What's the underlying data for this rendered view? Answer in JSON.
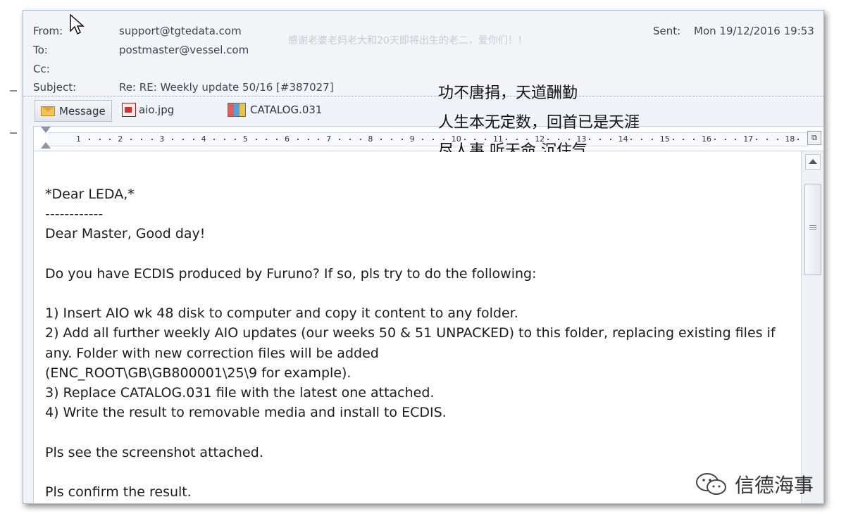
{
  "header": {
    "from_label": "From:",
    "from_value": "support@tgtedata.com",
    "to_label": "To:",
    "to_value": "postmaster@vessel.com",
    "cc_label": "Cc:",
    "subject_label": "Subject:",
    "subject_value": "Re: RE: Weekly update 50/16 [#387027]",
    "sent_label": "Sent:",
    "sent_value": "Mon 19/12/2016 19:53",
    "faint_note": "感谢老婆老妈老大和20天即将出生的老二，爱你们！！"
  },
  "attachments": {
    "message_label": "Message",
    "items": [
      "aio.jpg",
      "CATALOG.031"
    ]
  },
  "ruler": {
    "numbers": [
      "1",
      "2",
      "3",
      "4",
      "5",
      "6",
      "7",
      "8",
      "9",
      "10",
      "11",
      "12",
      "13",
      "14",
      "15",
      "16",
      "17",
      "18"
    ]
  },
  "body": {
    "lines": [
      "*Dear LEDA,*",
      "------------",
      "Dear Master, Good day!",
      "",
      "Do you have ECDIS produced by Furuno? If so, pls try to do the following:",
      "",
      "1) Insert AIO wk 48 disk to computer and copy it content to any folder.",
      "2) Add all further weekly AIO updates (our weeks 50 & 51 UNPACKED) to this folder, replacing existing files if",
      "any. Folder with new correction files will be added",
      "(ENC_ROOT\\GB\\GB800001\\25\\9 for example).",
      "3) Replace CATALOG.031 file with the latest one attached.",
      "4) Write the result to removable media and install to ECDIS.",
      "",
      "Pls see the screenshot attached.",
      "",
      "Pls confirm the result."
    ]
  },
  "overlay": {
    "line1": "功不唐捐，天道酬勤",
    "line2": "人生本无定数，回首已是天涯",
    "line3": "尽人事 听天命 沉住气 …"
  },
  "brand": {
    "name": "信德海事",
    "icon": "wechat-icon"
  }
}
